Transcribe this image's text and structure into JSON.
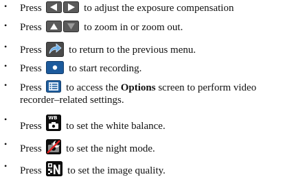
{
  "items": [
    {
      "press": "Press",
      "icon": "left-right-arrows-icon",
      "text": "to adjust the exposure compensation"
    },
    {
      "press": "Press",
      "icon": "up-down-arrows-icon",
      "text": "to zoom in or zoom out."
    },
    {
      "press": "Press",
      "icon": "return-arrow-icon",
      "text": "to return to the previous menu."
    },
    {
      "press": "Press",
      "icon": "record-dot-icon",
      "text": "to start recording."
    },
    {
      "press": "Press",
      "icon": "options-list-icon",
      "text_before": "to access the",
      "text_bold": "Options",
      "text_after": "screen to perform video recorder–related settings."
    },
    {
      "press": "Press",
      "icon": "white-balance-icon",
      "text": "to set the white balance."
    },
    {
      "press": "Press",
      "icon": "night-mode-icon",
      "text": "to set the night mode."
    },
    {
      "press": "Press",
      "icon": "image-quality-icon",
      "text": "to set the image quality."
    }
  ],
  "bullet_symbol": "•",
  "icon_labels": {
    "white_balance": "WB"
  }
}
